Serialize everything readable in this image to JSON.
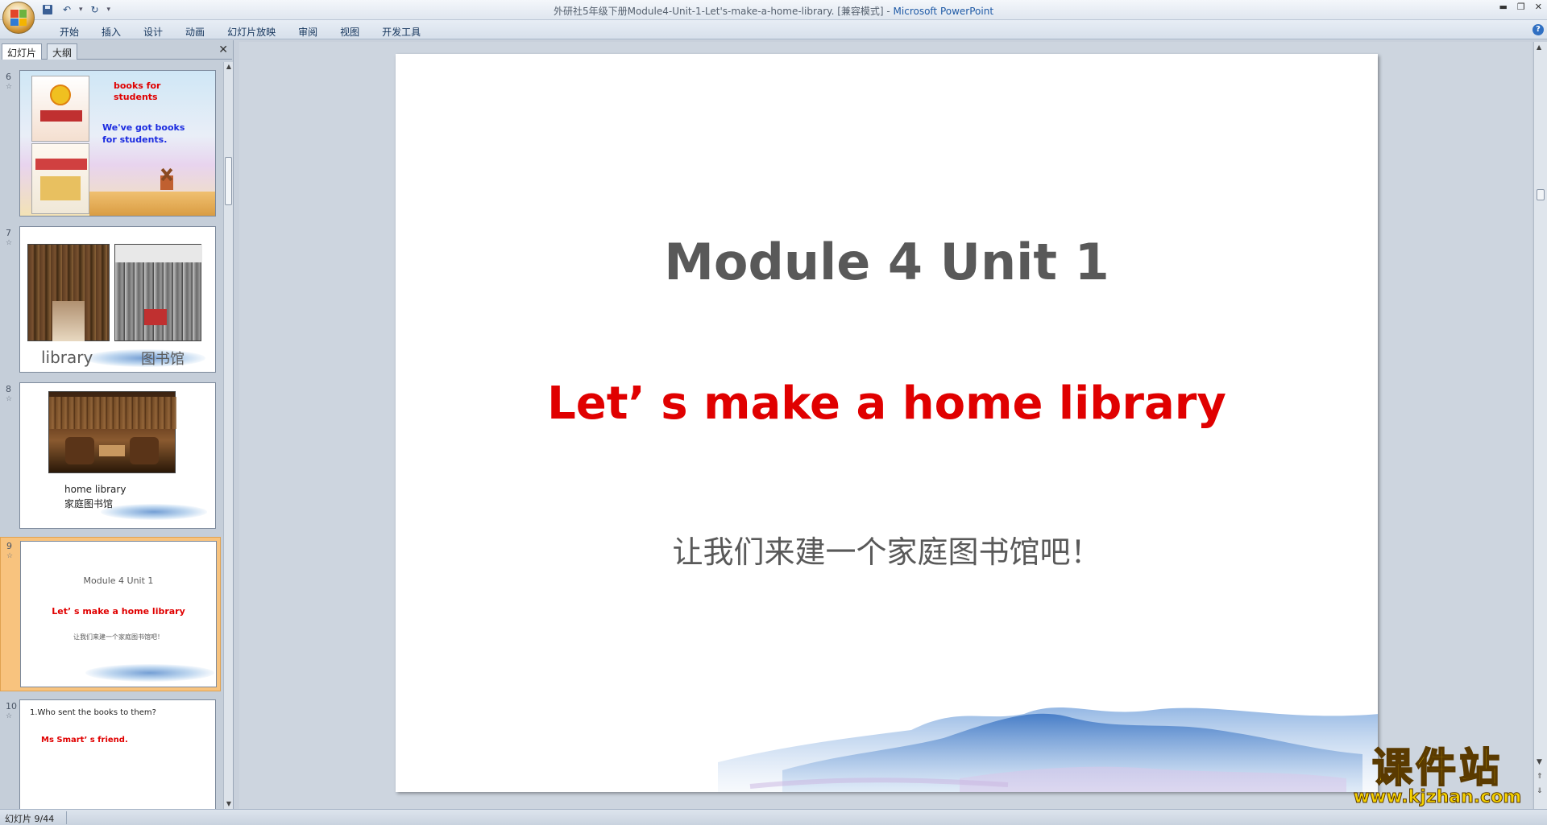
{
  "window": {
    "title": "外研社5年级下册Module4-Unit-1-Let's-make-a-home-library. [兼容模式] - ",
    "app_name": "Microsoft PowerPoint"
  },
  "ribbon": {
    "tabs": [
      "开始",
      "插入",
      "设计",
      "动画",
      "幻灯片放映",
      "审阅",
      "视图",
      "开发工具"
    ]
  },
  "panel": {
    "tabs": [
      "幻灯片",
      "大纲"
    ],
    "close": "✕"
  },
  "thumbnails": [
    {
      "number": "6",
      "line1": "books for",
      "line2": "students",
      "line3": "We've got books",
      "line4": "for students."
    },
    {
      "number": "7",
      "caption_en": "library",
      "caption_cn": "图书馆"
    },
    {
      "number": "8",
      "caption_en": "home library",
      "caption_cn": "家庭图书馆"
    },
    {
      "number": "9",
      "title": "Module 4  Unit 1",
      "subtitle": "Let’ s make a home  library",
      "chinese": "让我们来建一个家庭图书馆吧！"
    },
    {
      "number": "10",
      "question": "1.Who sent  the books to them?",
      "answer": "Ms Smart’ s friend."
    }
  ],
  "slide": {
    "title": "Module 4 Unit 1",
    "subtitle": "Let’ s make a home library",
    "chinese": "让我们来建一个家庭图书馆吧！"
  },
  "watermark": {
    "text_cn": "课件站",
    "url": "www.kjzhan.com"
  },
  "status": {
    "slide_counter": "幻灯片 9/44"
  },
  "colors": {
    "selected_thumb": "#f8c37e",
    "subtitle_red": "#e00000",
    "title_gray": "#595959",
    "watermark_yellow": "#f5d200"
  }
}
